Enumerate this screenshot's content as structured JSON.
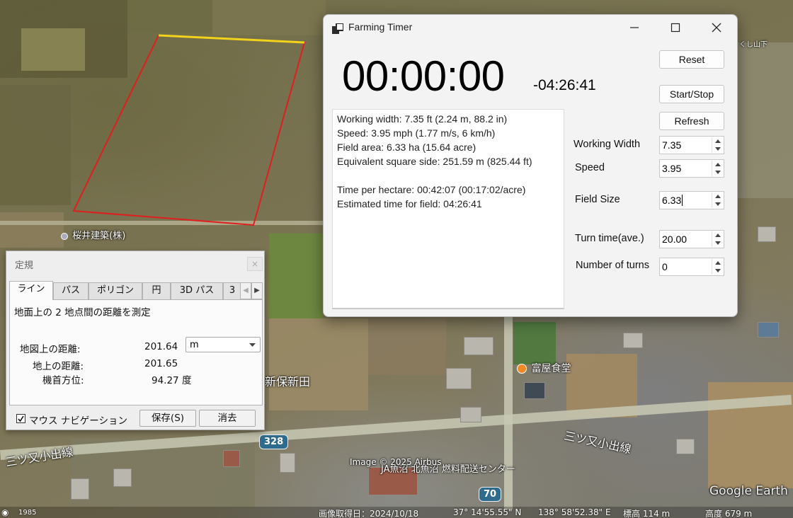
{
  "map": {
    "labels": {
      "company": "桜井建築(株)",
      "district": "新保新田",
      "restaurant": "富屋食堂",
      "road_left": "三ツ又小出線",
      "road_right": "三ツ又小出線",
      "fuel_center": "JA魚沼 北魚沼 燃料配送センター",
      "copyright": "Image © 2025 Airbus",
      "route_328": "328",
      "route_70": "70",
      "google_earth": "Google Earth",
      "top_right": "くし山下"
    },
    "statusbar": {
      "scale": "1985",
      "capture_date": "画像取得日：2024/10/18",
      "lat": "37° 14'55.55\" N",
      "lon": "138° 58'52.38\" E",
      "elevation": "標高   114 m",
      "eye_alt": "高度   679 m"
    }
  },
  "farming_timer": {
    "title": "Farming Timer",
    "elapsed": "00:00:00",
    "remaining": "-04:26:41",
    "buttons": {
      "reset": "Reset",
      "start_stop": "Start/Stop",
      "refresh": "Refresh"
    },
    "info_lines": [
      "Working width: 7.35 ft (2.24 m, 88.2 in)",
      "Speed: 3.95 mph (1.77 m/s, 6 km/h)",
      "Field area: 6.33 ha (15.64 acre)",
      "Equivalent square side: 251.59 m (825.44 ft)",
      "",
      "Time per hectare: 00:42:07 (00:17:02/acre)",
      "Estimated time for field: 04:26:41"
    ],
    "fields": {
      "working_width": {
        "label": "Working Width",
        "value": "7.35"
      },
      "speed": {
        "label": "Speed",
        "value": "3.95"
      },
      "field_size": {
        "label": "Field Size",
        "value": "6.33"
      },
      "turn_time": {
        "label": "Turn time(ave.)",
        "value": "20.00"
      },
      "number_of_turns": {
        "label": "Number of turns",
        "value": "0"
      }
    }
  },
  "ruler": {
    "title": "定規",
    "close": "×",
    "tabs": [
      "ライン",
      "パス",
      "ポリゴン",
      "円",
      "3D パス",
      "3"
    ],
    "description": "地面上の 2 地点間の距離を測定",
    "map_distance_label": "地図上の距離:",
    "map_distance_value": "201.64",
    "unit": "m",
    "ground_distance_label": "地上の距離:",
    "ground_distance_value": "201.65",
    "heading_label": "機首方位:",
    "heading_value": "94.27 度",
    "mouse_nav_label": "マウス ナビゲーション",
    "save_label": "保存(S)",
    "clear_label": "消去"
  },
  "colors": {
    "measure_line": "#e01e1e",
    "measure_highlight": "#f2d21a",
    "route_shield": "#2f6b8c"
  }
}
